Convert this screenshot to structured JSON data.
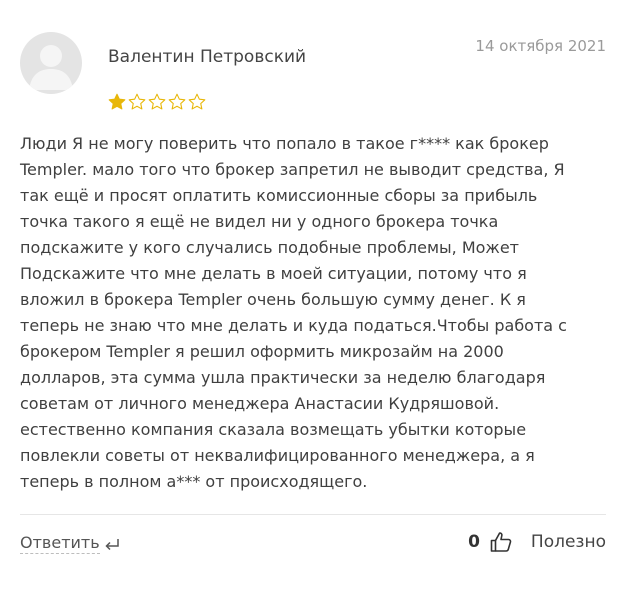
{
  "review": {
    "author": "Валентин Петровский",
    "date": "14 октября 2021",
    "rating": 1,
    "rating_max": 5,
    "lines": [
      "Люди Я не могу поверить что попало в такое г**** как брокер",
      "Templer. мало того что брокер запретил не выводит средства, Я",
      "так ещё и просят оплатить комиссионные сборы за прибыль",
      "точка такого я ещё не видел ни у одного брокера точка",
      "подскажите у кого случались подобные проблемы, Может",
      "Подскажите что мне делать в моей ситуации, потому что я",
      "вложил в брокера Templer очень большую сумму денег. К я",
      "теперь не знаю что мне делать и куда податься.Чтобы работа с",
      "брокером Templer я решил оформить микрозайм на 2000",
      "долларов, эта сумма ушла практически за неделю благодаря",
      "советам от личного менеджера Анастасии Кудряшовой.",
      "естественно компания сказала возмещать убытки которые",
      "повлекли советы от неквалифицированного менеджера, а я",
      "теперь в полном а*** от происходящего."
    ]
  },
  "actions": {
    "reply_label": "Ответить",
    "like_count": "0",
    "useful_label": "Полезно"
  },
  "icons": {
    "avatar": "user-avatar-placeholder",
    "reply": "reply-arrow-icon",
    "like": "thumbs-up-icon",
    "star_filled": "star-filled-icon",
    "star_empty": "star-outline-icon"
  },
  "colors": {
    "star": "#e8b70a",
    "avatar_bg": "#e4e4e4"
  }
}
